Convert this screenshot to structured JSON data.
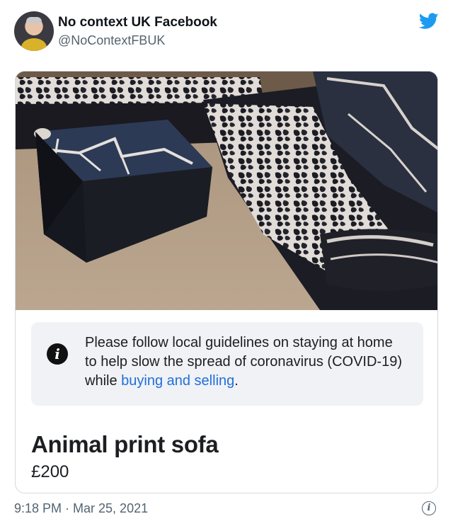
{
  "tweet": {
    "display_name": "No context UK Facebook",
    "handle": "@NoContextFBUK",
    "brand_color": "#1d9bf0",
    "timestamp": "9:18 PM · Mar 25, 2021"
  },
  "listing": {
    "notice_text": "Please follow local guidelines on staying at home to help slow the spread of coronavirus (COVID-19) while ",
    "notice_link": "buying and selling",
    "notice_end": ".",
    "title": "Animal print sofa",
    "price": "£200"
  },
  "icons": {
    "brand": "twitter-bird-icon",
    "notice": "info-icon",
    "footer": "info-circle-icon"
  }
}
